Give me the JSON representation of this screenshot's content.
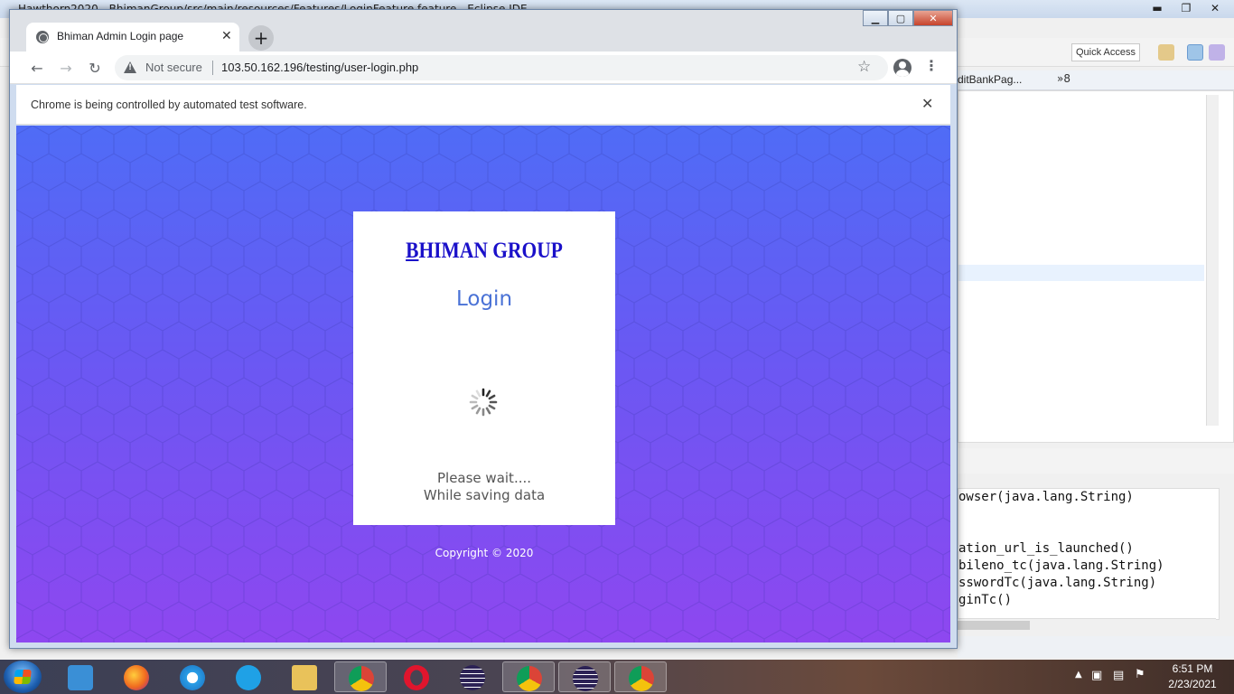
{
  "background_ide": {
    "title": "Hawthorn2020 - BhimanGroup/src/main/resources/Features/LoginFeature.feature - Eclipse IDE",
    "quick_access": "Quick Access",
    "editor_tab": "ditBankPag...",
    "more_tabs": "»8",
    "console_lines": [
      "owser(java.lang.String)",
      "",
      "",
      "ation_url_is_launched()",
      "bileno_tc(java.lang.String)",
      "sswordTc(java.lang.String)",
      "ginTc()"
    ]
  },
  "browser": {
    "tab_title": "Bhiman Admin Login page",
    "security_label": "Not secure",
    "url": "103.50.162.196/testing/user-login.php",
    "infobar_text": "Chrome is being controlled by automated test software."
  },
  "page": {
    "brand_first": "B",
    "brand_rest": "HIMAN GROUP",
    "heading": "Login",
    "wait_line1": "Please wait....",
    "wait_line2": "While saving data",
    "copyright": "Copyright © 2020",
    "colors": {
      "gradient_top": "#4f6cf6",
      "gradient_bottom": "#8e47f0",
      "brand": "#1a10c9",
      "heading": "#4a72d6"
    }
  },
  "taskbar": {
    "apps": [
      "media-player",
      "firefox",
      "internet-explorer",
      "skype",
      "file-explorer",
      "chrome",
      "opera",
      "eclipse",
      "chrome",
      "eclipse",
      "chrome"
    ],
    "time": "6:51 PM",
    "date": "2/23/2021"
  }
}
